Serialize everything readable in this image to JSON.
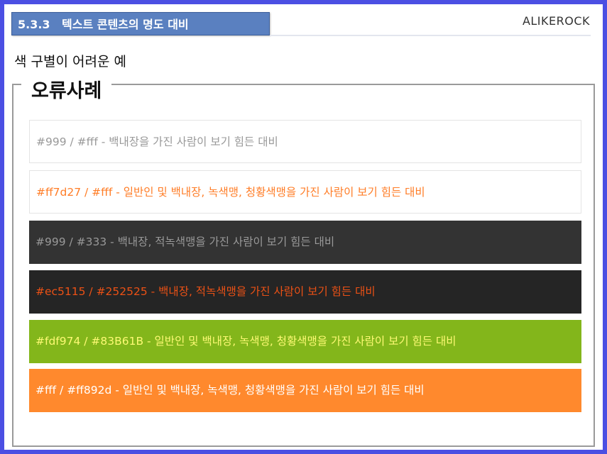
{
  "header": {
    "section_number": "5.3.3",
    "section_title": "텍스트 콘텐츠의 명도 대비",
    "brand": "ALIKEROCK"
  },
  "subtitle": "색 구별이 어려운 예",
  "legend": "오류사례",
  "examples": [
    {
      "text": "#999 / #fff - 백내장을 가진 사람이 보기 힘든 대비",
      "fg": "#999999",
      "bg": "#ffffff"
    },
    {
      "text": "#ff7d27 / #fff - 일반인 및 백내장, 녹색맹, 청황색맹을 가진 사람이 보기 힘든 대비",
      "fg": "#ff7d27",
      "bg": "#ffffff"
    },
    {
      "text": "#999 / #333 - 백내장, 적녹색맹을 가진 사람이 보기 힘든 대비",
      "fg": "#999999",
      "bg": "#333333"
    },
    {
      "text": "#ec5115 / #252525 - 백내장, 적녹색맹을 가진 사람이 보기 힘든 대비",
      "fg": "#ec5115",
      "bg": "#252525"
    },
    {
      "text": "#fdf974 / #83B61B - 일반인 및 백내장, 녹색맹, 청황색맹을 가진 사람이 보기 힘든 대비",
      "fg": "#fdf974",
      "bg": "#83B61B"
    },
    {
      "text": "#fff / #ff892d - 일반인 및 백내장, 녹색맹, 청황색맹을 가진 사람이 보기 힘든 대비",
      "fg": "#ffffff",
      "bg": "#ff892d"
    }
  ]
}
